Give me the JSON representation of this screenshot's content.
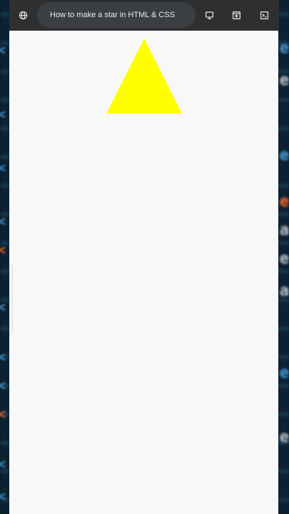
{
  "window": {
    "url_title": "How to make a star in HTML & CSS"
  },
  "icons": {
    "site_info": "globe-icon",
    "device": "monitor-icon",
    "open_tab": "open-in-new-tab-icon",
    "console": "terminal-icon"
  },
  "page": {
    "shape": "triangle",
    "shape_color": "#ffff00",
    "background": "#f8f8f8"
  },
  "colors": {
    "toolbar": "#2d2f31",
    "url_pill": "#3c3f42",
    "url_text": "#eceef0"
  }
}
